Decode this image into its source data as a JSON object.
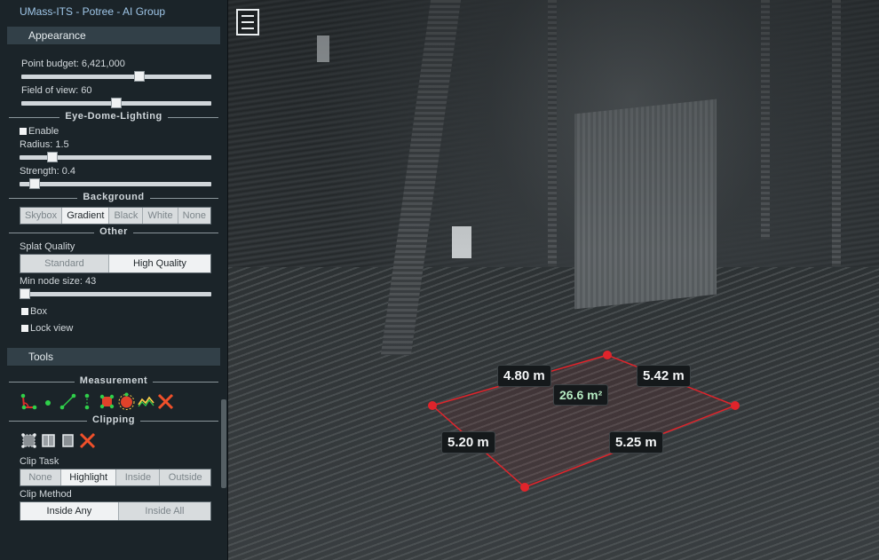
{
  "app": {
    "title": "UMass-ITS - Potree - AI Group"
  },
  "appearance": {
    "header": "Appearance",
    "point_budget_label": "Point budget: 6,421,000",
    "point_budget_fraction": 0.62,
    "fov_label": "Field of view: 60",
    "fov_fraction": 0.5
  },
  "edl": {
    "heading": "Eye-Dome-Lighting",
    "enable_label": "Enable",
    "radius_label": "Radius: 1.5",
    "radius_fraction": 0.17,
    "strength_label": "Strength: 0.4",
    "strength_fraction": 0.08
  },
  "background": {
    "heading": "Background",
    "options": [
      "Skybox",
      "Gradient",
      "Black",
      "White",
      "None"
    ],
    "selected": "Gradient"
  },
  "other": {
    "heading": "Other",
    "splat_label": "Splat Quality",
    "splat_options": [
      "Standard",
      "High Quality"
    ],
    "splat_selected": "High Quality",
    "min_node_label": "Min node size: 43",
    "min_node_fraction": 0.03,
    "box_label": "Box",
    "lock_label": "Lock view"
  },
  "tools": {
    "header": "Tools",
    "measurement_heading": "Measurement",
    "measurement_icons": [
      "angle-icon",
      "point-icon",
      "distance-icon",
      "height-icon",
      "area-icon",
      "volume-icon",
      "profile-icon",
      "remove-measurements-icon"
    ],
    "clipping_heading": "Clipping",
    "clipping_icons": [
      "clip-volume-icon",
      "clip-box-icon",
      "clip-plane-icon",
      "remove-clip-icon"
    ],
    "clip_task_label": "Clip Task",
    "clip_task_options": [
      "None",
      "Highlight",
      "Inside",
      "Outside"
    ],
    "clip_task_selected": "Highlight",
    "clip_method_label": "Clip Method",
    "clip_method_options": [
      "Inside Any",
      "Inside All"
    ],
    "clip_method_selected": "Inside Any"
  },
  "viewer": {
    "menu_icon": "hamburger-menu-icon",
    "measurement_color": "#e0242b",
    "measurements": {
      "edge_top_left": "4.80 m",
      "edge_top_right": "5.42 m",
      "edge_bottom_left": "5.20 m",
      "edge_bottom_right": "5.25 m",
      "area": "26.6 m²"
    }
  }
}
